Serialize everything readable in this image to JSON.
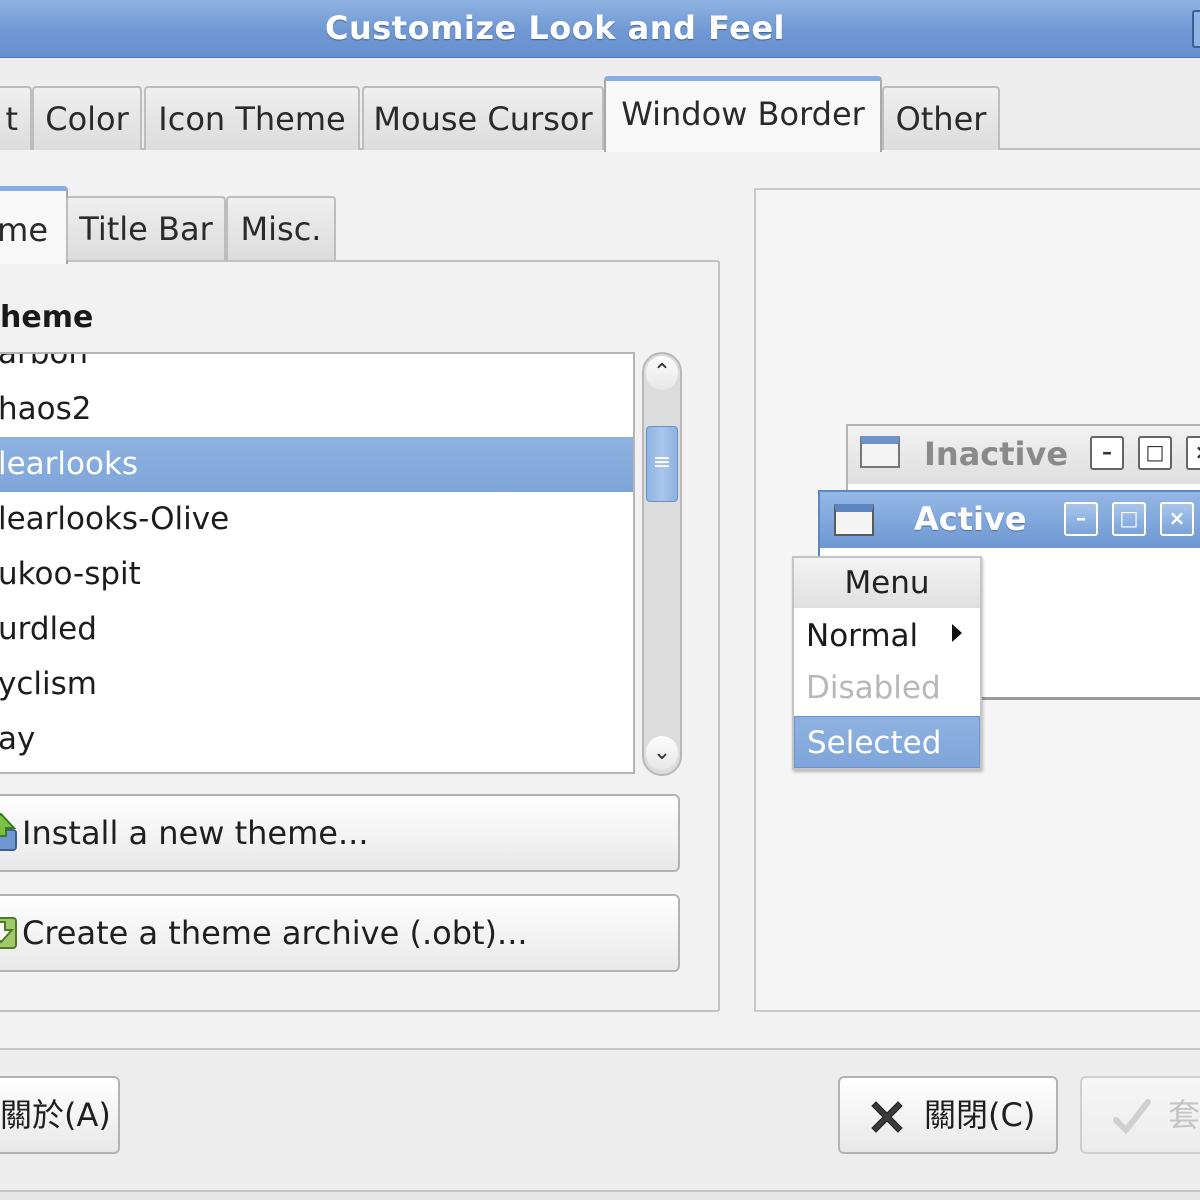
{
  "window": {
    "title": "Customize Look and Feel"
  },
  "main_tabs": [
    {
      "label": "t"
    },
    {
      "label": "Color"
    },
    {
      "label": "Icon Theme"
    },
    {
      "label": "Mouse Cursor"
    },
    {
      "label": "Window Border",
      "active": true
    },
    {
      "label": "Other"
    }
  ],
  "sub_tabs": [
    {
      "label": "me",
      "active": true
    },
    {
      "label": "Title Bar"
    },
    {
      "label": "Misc."
    }
  ],
  "theme_section": {
    "heading": "heme",
    "items": [
      "arbon",
      "haos2",
      "learlooks",
      "learlooks-Olive",
      "ukoo-spit",
      "urdled",
      "yclism",
      "ay"
    ],
    "selected_index": 2
  },
  "buttons": {
    "install": "Install a new theme...",
    "archive": "Create a theme archive (.obt)...",
    "about": "關於(A)",
    "close": "關閉(C)",
    "apply": "套"
  },
  "preview": {
    "inactive_title": "Inactive",
    "active_title": "Active",
    "menu": {
      "header": "Menu",
      "normal": "Normal",
      "disabled": "Disabled",
      "selected": "Selected"
    }
  },
  "colors": {
    "accent": "#7ea5da",
    "titlebar": "#6f98d3"
  }
}
